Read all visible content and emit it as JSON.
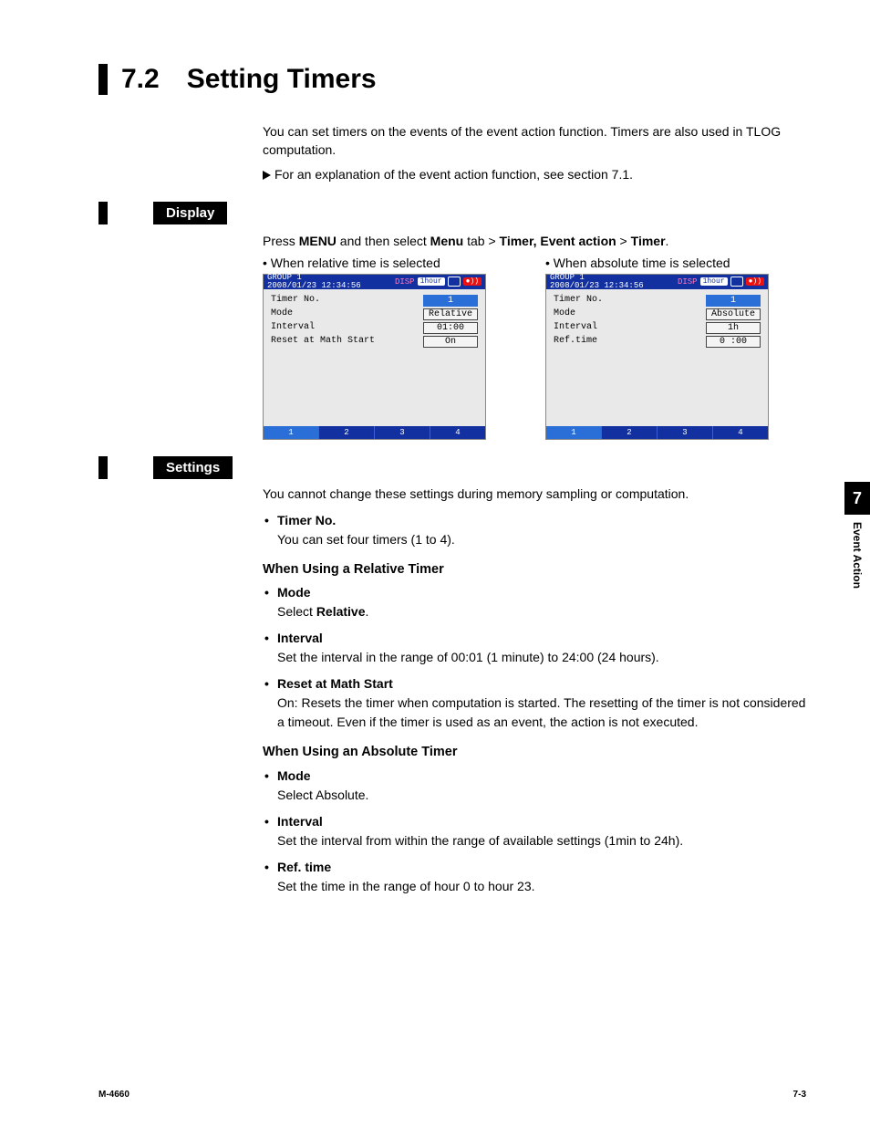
{
  "title": {
    "num": "7.2",
    "text": "Setting Timers"
  },
  "intro": "You can set timers on the events of the event action function. Timers are also used in TLOG computation.",
  "xref": "For an explanation of the event action function, see section 7.1.",
  "display": {
    "label": "Display",
    "menu_pre": "Press ",
    "menu_b1": "MENU",
    "menu_mid1": " and then select ",
    "menu_b2": "Menu",
    "menu_mid2": " tab > ",
    "menu_b3": "Timer, Event action",
    "menu_mid3": " > ",
    "menu_b4": "Timer",
    "menu_post": ".",
    "cap_rel": "•   When relative time is selected",
    "cap_abs": "•   When absolute time is selected",
    "lcd": {
      "group": "GROUP 1",
      "datetime": "2008/01/23 12:34:56",
      "chip": "1hour",
      "tabs": [
        "1",
        "2",
        "3",
        "4"
      ],
      "rel": {
        "r1k": "Timer No.",
        "r1v": "1",
        "r2k": "Mode",
        "r2v": "Relative",
        "r3k": "Interval",
        "r3v": "01:00",
        "r4k": "Reset at Math Start",
        "r4v": "On"
      },
      "abs": {
        "r1k": "Timer No.",
        "r1v": "1",
        "r2k": "Mode",
        "r2v": "Absolute",
        "r3k": "Interval",
        "r3v": "1h",
        "r4k": "Ref.time",
        "r4v": "0 :00"
      }
    }
  },
  "settings": {
    "label": "Settings",
    "lead": "You cannot change these settings during memory sampling or computation.",
    "timerno_t": "Timer No.",
    "timerno_b": "You can set four timers (1 to 4).",
    "rel_h": "When Using a Relative Timer",
    "rel_mode_t": "Mode",
    "rel_mode_pre": "Select ",
    "rel_mode_b": "Relative",
    "rel_mode_post": ".",
    "rel_int_t": "Interval",
    "rel_int_b": "Set the interval in the range of 00:01 (1 minute) to 24:00 (24 hours).",
    "rel_reset_t": "Reset at Math Start",
    "rel_reset_b": "On:   Resets the timer when computation is started. The resetting of the timer is not considered a timeout. Even if the timer is used as an event, the action is not executed.",
    "abs_h": "When Using an Absolute Timer",
    "abs_mode_t": "Mode",
    "abs_mode_b": "Select Absolute.",
    "abs_int_t": "Interval",
    "abs_int_b": "Set the interval from within the range of available settings (1min to 24h).",
    "abs_ref_t": "Ref. time",
    "abs_ref_b": "Set the time in the range of hour 0 to hour 23."
  },
  "side": {
    "num": "7",
    "label": "Event Action"
  },
  "footer": {
    "left": "M-4660",
    "right": "7-3"
  }
}
